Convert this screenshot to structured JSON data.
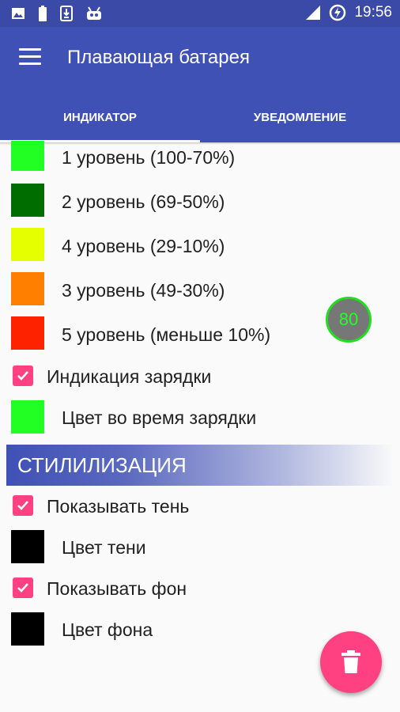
{
  "status_bar": {
    "time": "19:56",
    "icons_left": [
      "image-icon",
      "battery-full-icon",
      "download-icon",
      "android-icon"
    ],
    "icons_right": [
      "signal-icon",
      "battery-charging-icon"
    ]
  },
  "app_bar": {
    "title": "Плавающая батарея",
    "menu_icon": "hamburger-menu-icon"
  },
  "tabs": [
    {
      "label": "ИНДИКАТОР",
      "active": true
    },
    {
      "label": "УВЕДОМЛЕНИЕ",
      "active": false
    }
  ],
  "colors": {
    "primary": "#3f51b5",
    "status_bar": "#3a4aa6",
    "accent": "#ff4081"
  },
  "levels": [
    {
      "label": "1 уровень (100-70%)",
      "color": "#22ff22"
    },
    {
      "label": "2 уровень (69-50%)",
      "color": "#006d00"
    },
    {
      "label": "4 уровень (29-10%)",
      "color": "#e6ff00"
    },
    {
      "label": "3 уровень (49-30%)",
      "color": "#ff8000"
    },
    {
      "label": "5 уровень (меньше 10%)",
      "color": "#ff2200"
    }
  ],
  "charging": {
    "checkbox_label": "Индикация зарядки",
    "checked": true,
    "color_label": "Цвет во время зарядки",
    "color": "#22ff22"
  },
  "stylization": {
    "section_title": "СТИЛИЛИЗАЦИЯ",
    "show_shadow_label": "Показывать тень",
    "show_shadow_checked": true,
    "shadow_color_label": "Цвет тени",
    "shadow_color": "#000000",
    "show_background_label": "Показывать фон",
    "show_background_checked": true,
    "background_color_label": "Цвет фона",
    "background_color": "#000000"
  },
  "battery_bubble": {
    "value": "80"
  },
  "fab": {
    "icon": "trash-icon"
  }
}
